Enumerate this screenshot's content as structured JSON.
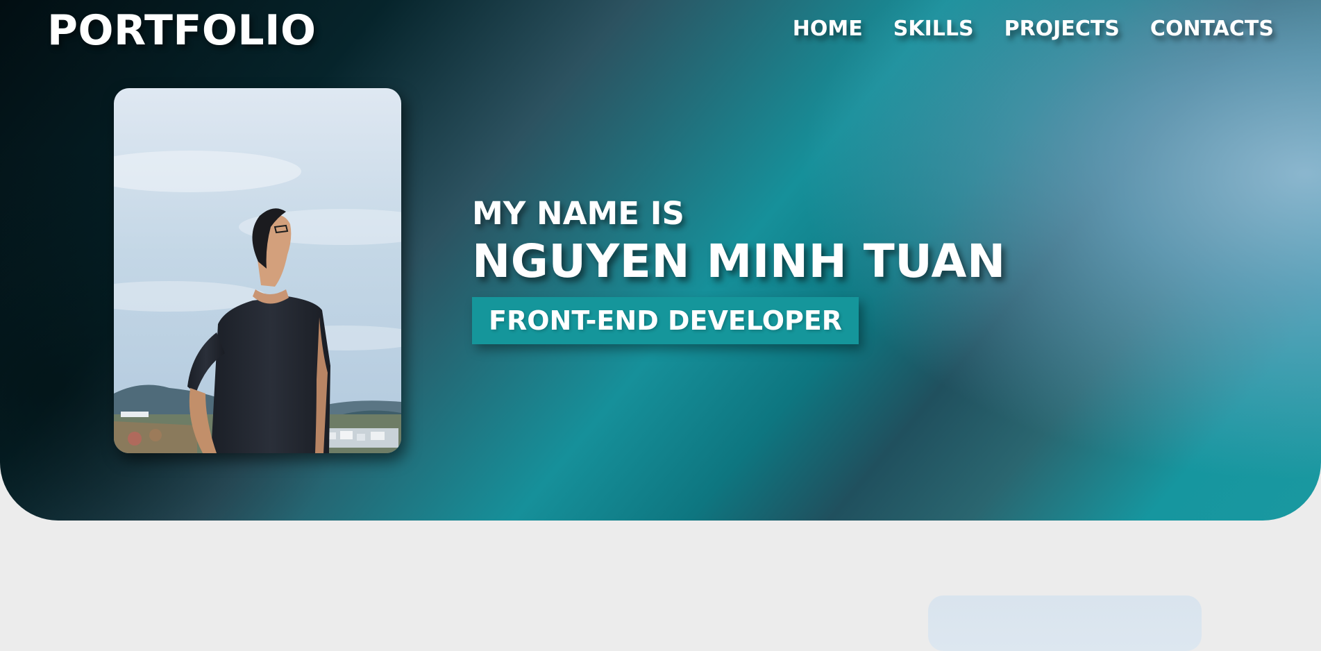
{
  "header": {
    "logo": "PORTFOLIO",
    "nav": [
      {
        "label": "HOME"
      },
      {
        "label": "SKILLS"
      },
      {
        "label": "PROJECTS"
      },
      {
        "label": "CONTACTS"
      }
    ]
  },
  "hero": {
    "intro": "MY NAME IS",
    "name": "NGUYEN MINH TUAN",
    "role": "FRONT-END DEVELOPER",
    "role_color": "#15969b",
    "photo": "profile-photo"
  },
  "colors": {
    "page_background": "#ececec",
    "hero_dark": "#020e12",
    "hero_teal": "#16909a",
    "hero_light": "#70a8c4",
    "text": "#ffffff"
  }
}
